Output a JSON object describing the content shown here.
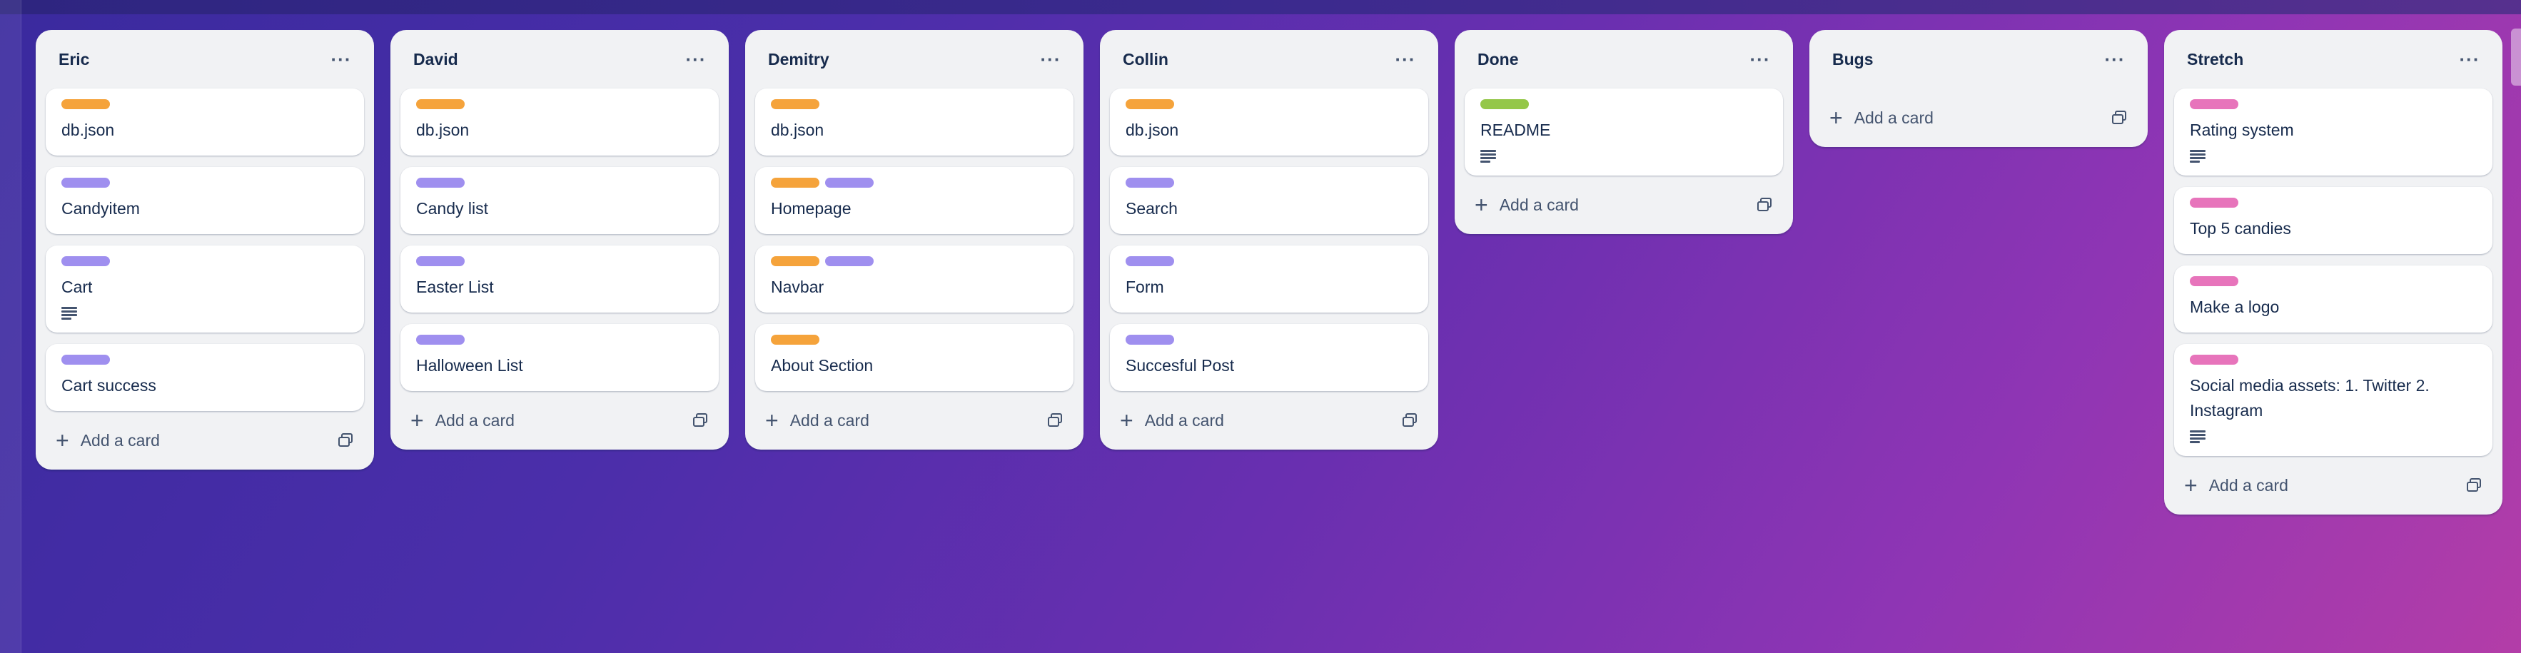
{
  "colors": {
    "orange": "#f5a33b",
    "purple": "#9f8fef",
    "green": "#94c748",
    "pink": "#e774bb"
  },
  "add_card_label": "Add a card",
  "icons": {
    "list_menu": "ellipsis-icon",
    "add": "plus-icon",
    "template": "card-template-icon",
    "description": "description-icon"
  },
  "lists": [
    {
      "title": "Eric",
      "cards": [
        {
          "title": "db.json",
          "labels": [
            "orange"
          ]
        },
        {
          "title": "Candyitem",
          "labels": [
            "purple"
          ]
        },
        {
          "title": "Cart",
          "labels": [
            "purple"
          ],
          "description": true
        },
        {
          "title": "Cart success",
          "labels": [
            "purple"
          ]
        }
      ]
    },
    {
      "title": "David",
      "cards": [
        {
          "title": "db.json",
          "labels": [
            "orange"
          ]
        },
        {
          "title": "Candy list",
          "labels": [
            "purple"
          ]
        },
        {
          "title": "Easter List",
          "labels": [
            "purple"
          ]
        },
        {
          "title": "Halloween List",
          "labels": [
            "purple"
          ]
        }
      ]
    },
    {
      "title": "Demitry",
      "cards": [
        {
          "title": "db.json",
          "labels": [
            "orange"
          ]
        },
        {
          "title": "Homepage",
          "labels": [
            "orange",
            "purple"
          ]
        },
        {
          "title": "Navbar",
          "labels": [
            "orange",
            "purple"
          ]
        },
        {
          "title": "About Section",
          "labels": [
            "orange"
          ]
        }
      ]
    },
    {
      "title": "Collin",
      "cards": [
        {
          "title": "db.json",
          "labels": [
            "orange"
          ]
        },
        {
          "title": "Search",
          "labels": [
            "purple"
          ]
        },
        {
          "title": "Form",
          "labels": [
            "purple"
          ]
        },
        {
          "title": "Succesful Post",
          "labels": [
            "purple"
          ]
        }
      ]
    },
    {
      "title": "Done",
      "cards": [
        {
          "title": "README",
          "labels": [
            "green"
          ],
          "description": true
        }
      ]
    },
    {
      "title": "Bugs",
      "cards": []
    },
    {
      "title": "Stretch",
      "cards": [
        {
          "title": "Rating system",
          "labels": [
            "pink"
          ],
          "description": true
        },
        {
          "title": "Top 5 candies",
          "labels": [
            "pink"
          ]
        },
        {
          "title": "Make a logo",
          "labels": [
            "pink"
          ]
        },
        {
          "title": "Social media assets: 1. Twitter 2. Instagram",
          "labels": [
            "pink"
          ],
          "description": true
        }
      ]
    }
  ]
}
